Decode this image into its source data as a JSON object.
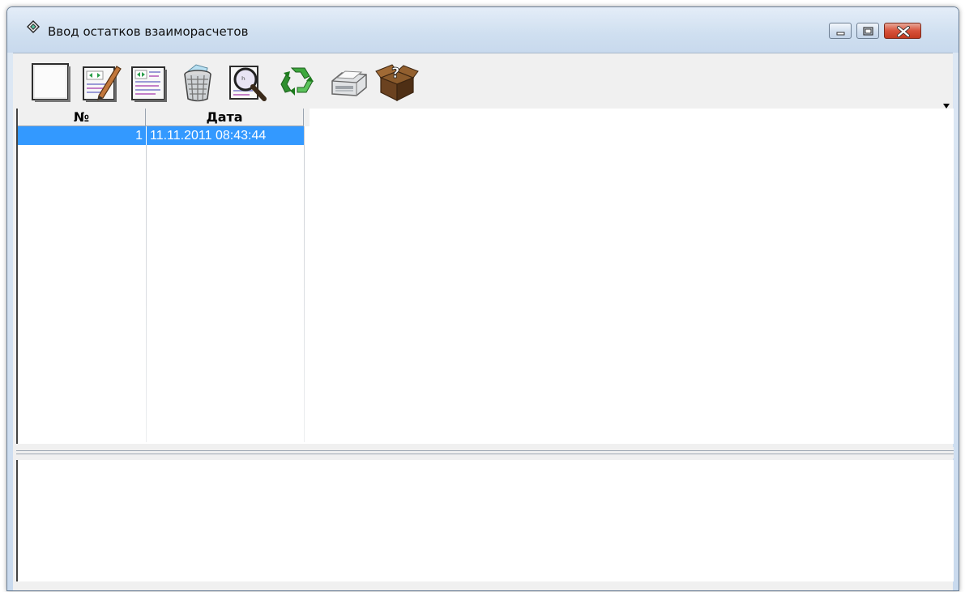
{
  "window": {
    "title": "Ввод остатков взаиморасчетов",
    "controls": [
      "minimize",
      "maximize",
      "close"
    ]
  },
  "toolbar": {
    "buttons": [
      {
        "icon": "blank-document-icon"
      },
      {
        "icon": "edit-document-icon"
      },
      {
        "icon": "copy-document-icon"
      },
      {
        "icon": "trash-basket-icon"
      },
      {
        "icon": "view-magnifier-icon"
      },
      {
        "icon": "recycle-refresh-icon"
      },
      {
        "icon": "printer-icon"
      },
      {
        "icon": "help-box-icon"
      }
    ],
    "overflow_icon": "chevron-down-icon"
  },
  "grid": {
    "columns": [
      "№",
      "Дата"
    ],
    "rows": [
      {
        "no": "1",
        "date": "11.11.2011 08:43:44",
        "selected": true
      }
    ],
    "selection_color": "#3399ff"
  }
}
